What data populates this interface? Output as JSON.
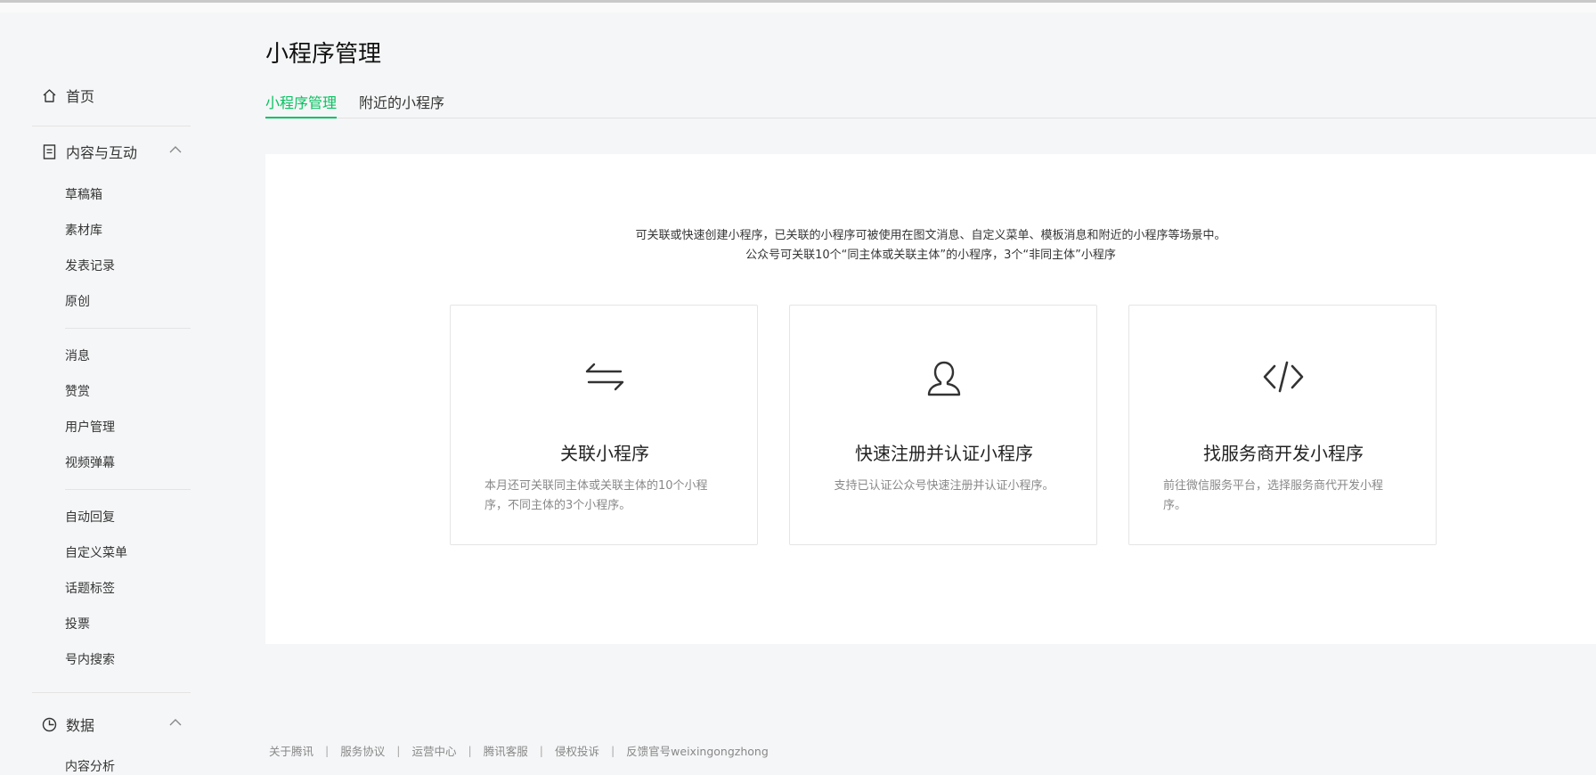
{
  "sidebar": {
    "home": "首页",
    "content": {
      "title": "内容与互动",
      "groups": [
        [
          "草稿箱",
          "素材库",
          "发表记录",
          "原创"
        ],
        [
          "消息",
          "赞赏",
          "用户管理",
          "视频弹幕"
        ],
        [
          "自动回复",
          "自定义菜单",
          "话题标签",
          "投票",
          "号内搜索"
        ]
      ]
    },
    "data": {
      "title": "数据",
      "first_item": "内容分析"
    }
  },
  "main": {
    "title": "小程序管理",
    "tabs": [
      {
        "label": "小程序管理",
        "active": true
      },
      {
        "label": "附近的小程序",
        "active": false
      }
    ],
    "description": [
      "可关联或快速创建小程序，已关联的小程序可被使用在图文消息、自定义菜单、模板消息和附近的小程序等场景中。",
      "公众号可关联10个“同主体或关联主体”的小程序，3个“非同主体”小程序"
    ],
    "cards": [
      {
        "icon": "swap-arrows-icon",
        "title": "关联小程序",
        "desc": "本月还可关联同主体或关联主体的10个小程序，不同主体的3个小程序。"
      },
      {
        "icon": "user-icon",
        "title": "快速注册并认证小程序",
        "desc": "支持已认证公众号快速注册并认证小程序。"
      },
      {
        "icon": "code-icon",
        "title": "找服务商开发小程序",
        "desc": "前往微信服务平台，选择服务商代开发小程序。"
      }
    ]
  },
  "footer": {
    "links": [
      "关于腾讯",
      "服务协议",
      "运营中心",
      "腾讯客服",
      "侵权投诉",
      "反馈官号weixingongzhong"
    ]
  },
  "colors": {
    "accent": "#07c160",
    "background": "#f5f6f7"
  }
}
